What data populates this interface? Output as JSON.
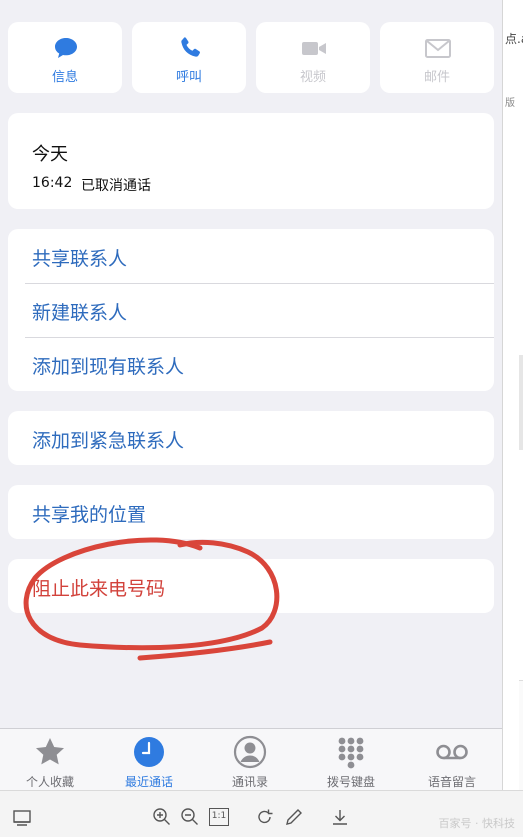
{
  "actions": [
    {
      "label": "信息",
      "icon": "message-bubble-icon",
      "enabled": true
    },
    {
      "label": "呼叫",
      "icon": "phone-icon",
      "enabled": true
    },
    {
      "label": "视频",
      "icon": "video-camera-icon",
      "enabled": false
    },
    {
      "label": "邮件",
      "icon": "mail-envelope-icon",
      "enabled": false
    }
  ],
  "recent": {
    "day": "今天",
    "time": "16:42",
    "status": "已取消通话"
  },
  "contact_options": [
    "共享联系人",
    "新建联系人",
    "添加到现有联系人"
  ],
  "emergency_label": "添加到紧急联系人",
  "share_location_label": "共享我的位置",
  "block_label": "阻止此来电号码",
  "tabs": [
    {
      "label": "个人收藏",
      "icon": "star-icon",
      "active": false
    },
    {
      "label": "最近通话",
      "icon": "clock-icon",
      "active": true
    },
    {
      "label": "通讯录",
      "icon": "person-circle-icon",
      "active": false
    },
    {
      "label": "拨号键盘",
      "icon": "keypad-icon",
      "active": false
    },
    {
      "label": "语音留言",
      "icon": "voicemail-icon",
      "active": false
    }
  ],
  "side_panel": {
    "text1": "点.a",
    "text2": "版"
  },
  "viewer_toolbar": {
    "fit_label": "1:1",
    "watermark": "百家号 · 快科技"
  },
  "colors": {
    "accent": "#2f7be0",
    "destructive": "#d2423b",
    "annotation": "#d9453a"
  }
}
